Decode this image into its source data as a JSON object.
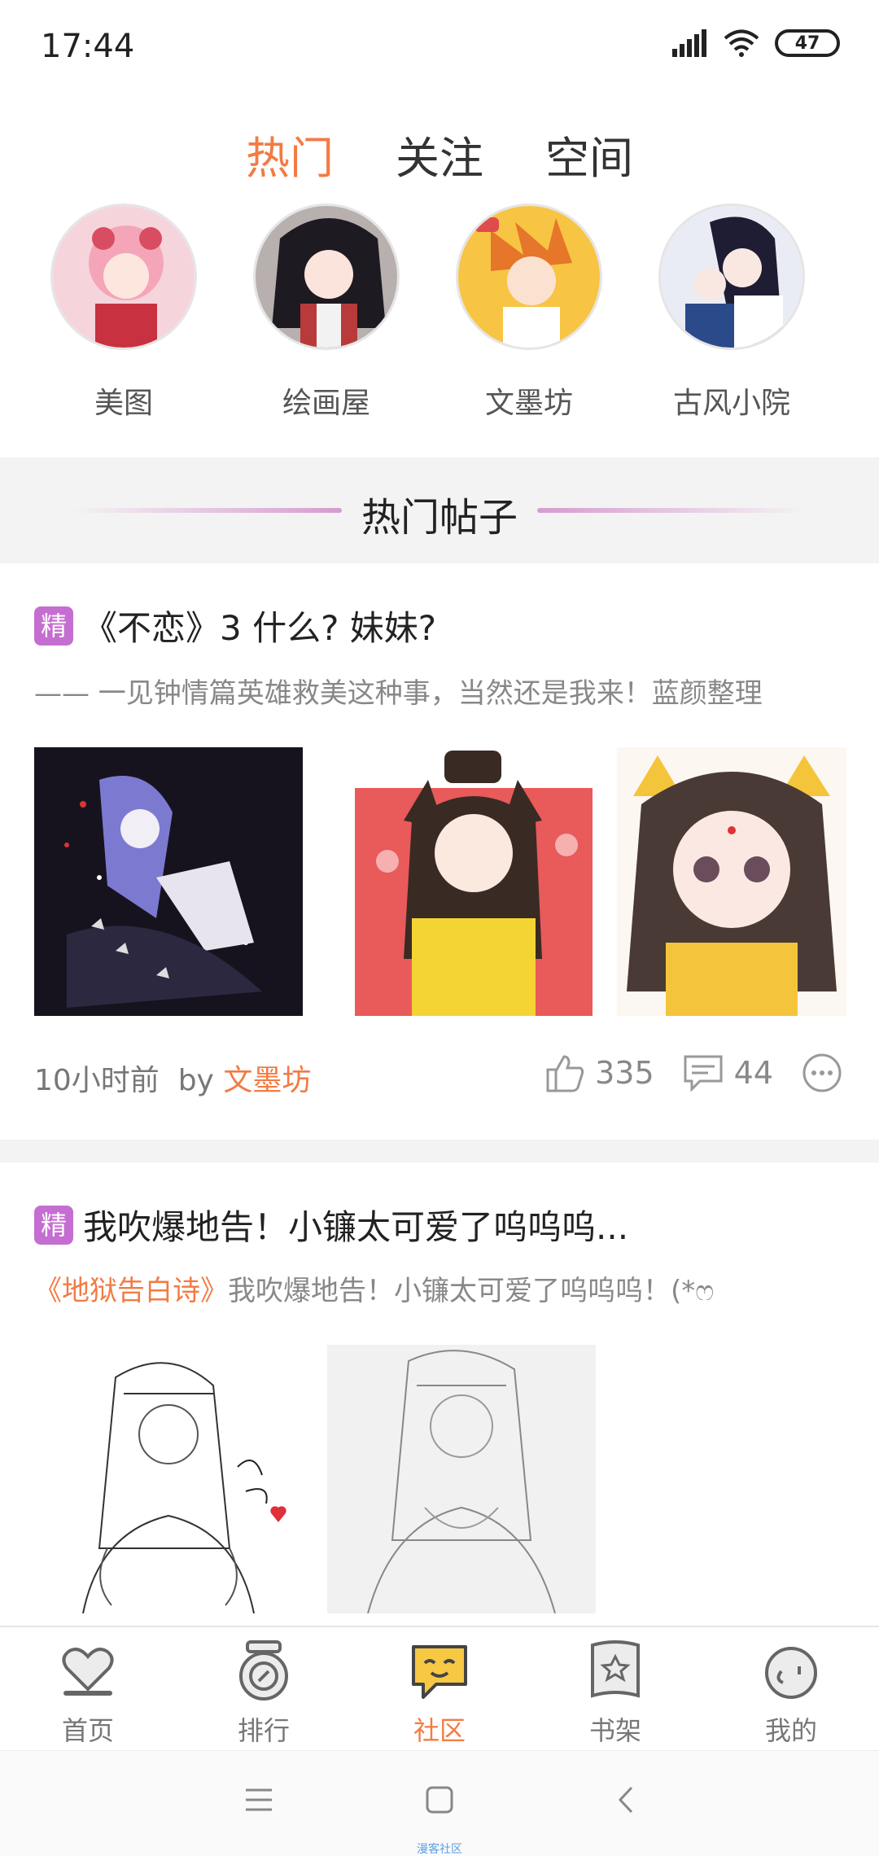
{
  "status_bar": {
    "time": "17:44",
    "battery": "47",
    "icons": [
      "signal-icon",
      "wifi-icon",
      "battery-icon"
    ]
  },
  "top_tabs": [
    {
      "label": "热门",
      "active": true
    },
    {
      "label": "关注",
      "active": false
    },
    {
      "label": "空间",
      "active": false
    }
  ],
  "categories": [
    {
      "label": "美图"
    },
    {
      "label": "绘画屋"
    },
    {
      "label": "文墨坊"
    },
    {
      "label": "古风小院"
    }
  ],
  "section": {
    "title": "热门帖子"
  },
  "posts": [
    {
      "badge": "精",
      "title": "《不恋》3 什么? 妹妹?",
      "subtitle": "—— 一见钟情篇英雄救美这种事，当然还是我来！蓝颜整理",
      "time": "10小时前",
      "by": "by",
      "author": "文墨坊",
      "likes": "335",
      "comments": "44"
    },
    {
      "badge": "精",
      "title": "我吹爆地告！小镰太可爱了呜呜呜...",
      "book_link": "《地狱告白诗》",
      "subtitle": "我吹爆地告！小镰太可爱了呜呜呜！(*ෆ"
    }
  ],
  "tabbar": [
    {
      "label": "首页",
      "icon": "heart-home-icon",
      "active": false
    },
    {
      "label": "排行",
      "icon": "medal-icon",
      "active": false
    },
    {
      "label": "社区",
      "icon": "chat-bubble-icon",
      "active": true
    },
    {
      "label": "书架",
      "icon": "book-icon",
      "active": false
    },
    {
      "label": "我的",
      "icon": "face-icon",
      "active": false
    }
  ],
  "system_nav": {
    "watermark": "漫客社区"
  },
  "colors": {
    "accent": "#f37b43",
    "badge": "#c56ed1",
    "gray_text": "#888888"
  }
}
